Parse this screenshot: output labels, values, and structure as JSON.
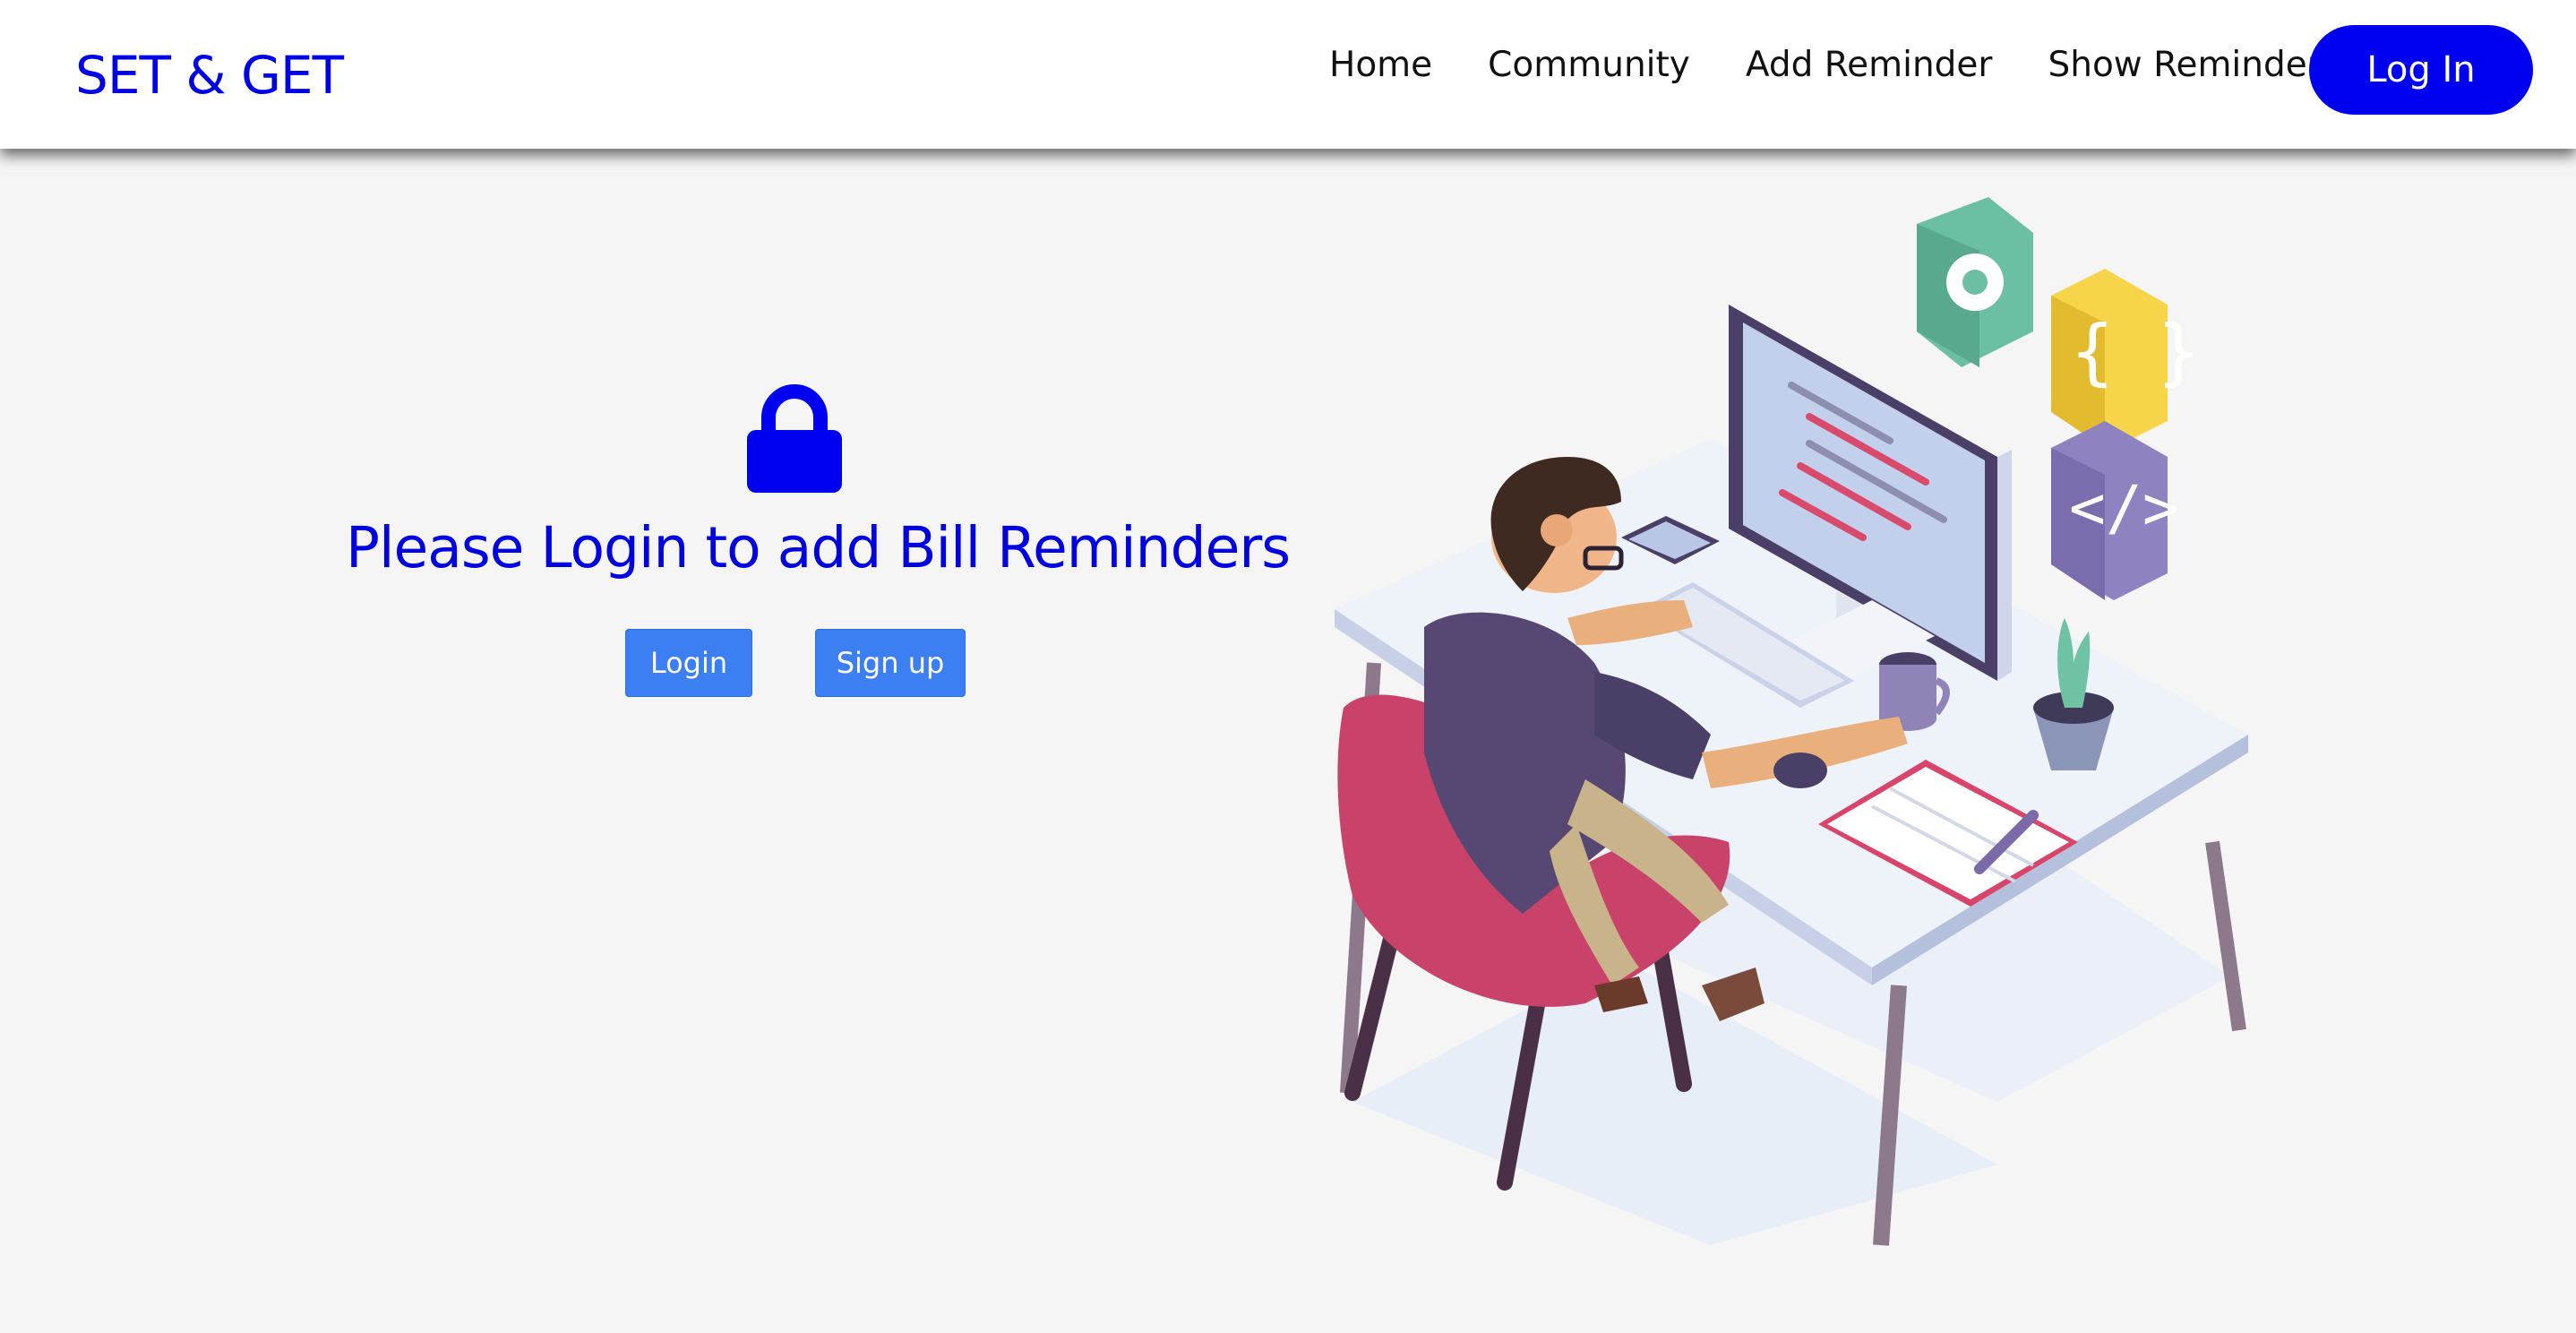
{
  "navbar": {
    "brand": "SET & GET",
    "links": [
      "Home",
      "Community",
      "Add Reminder",
      "Show Reminder"
    ],
    "login_label": "Log In"
  },
  "main": {
    "lock_icon": "lock-icon",
    "headline": "Please Login to add Bill Reminders",
    "login_button": "Login",
    "signup_button": "Sign up"
  },
  "colors": {
    "brand": "#0000e6",
    "primary_button": "#3b7ff2",
    "pill": "#0000f0",
    "background": "#f5f5f5"
  }
}
